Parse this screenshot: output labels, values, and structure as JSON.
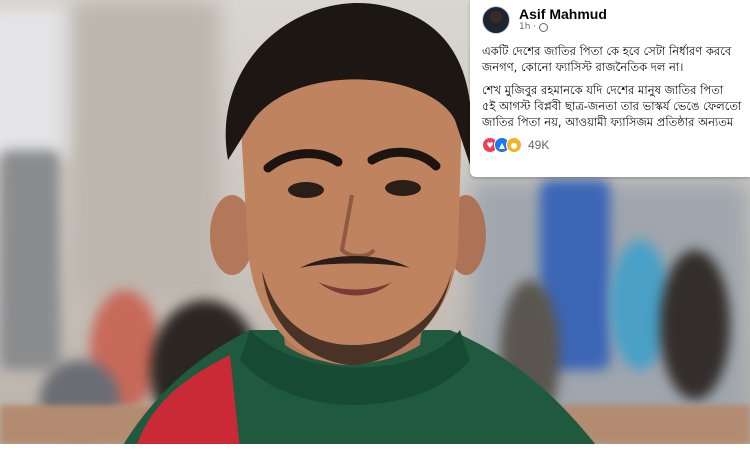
{
  "post": {
    "author": "Asif Mahmud",
    "time": "1h ·",
    "paragraph_1": [
      "একটি দেশের জাতির পিতা কে হবে সেটা নির্ধারণ করবে",
      "জনগণ, কোনো ফ্যাসিস্ট রাজনৈতিক দল না।"
    ],
    "paragraph_2": [
      "শেখ মুজিবুর রহমানকে যদি দেশের মানুষ জাতির পিতা",
      "৫ই আগস্ট বিপ্লবী ছাত্র-জনতা তার ভাস্কর্য ভেঙে ফেলতো",
      "জাতির পিতা নয়, আওয়ামী ফ্যাসিজম প্রতিষ্ঠার অন্যতম"
    ],
    "reaction_count": "49K",
    "reaction_icons": [
      "love-icon",
      "like-icon",
      "care-icon"
    ]
  },
  "colors": {
    "text": "#050505",
    "secondary": "#65676b",
    "like": "#1877f2",
    "love": "#f33e58",
    "care": "#f7b125",
    "flag_green": "#1f5a3f",
    "flag_red": "#c92a35"
  }
}
